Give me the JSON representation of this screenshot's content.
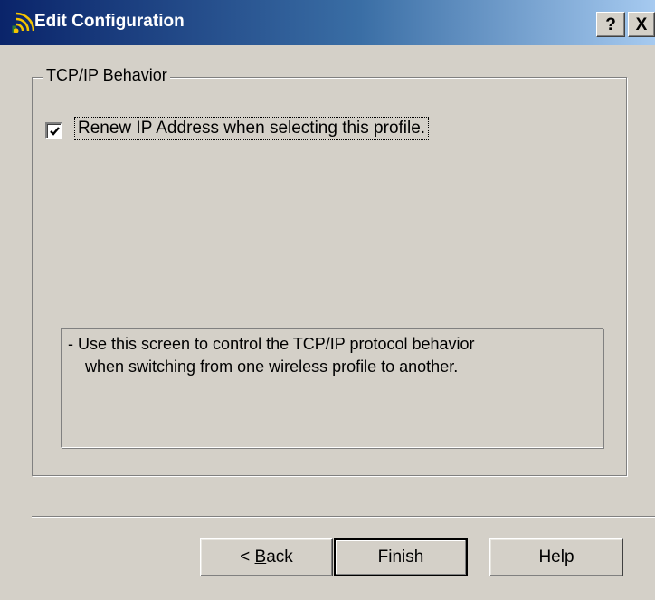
{
  "window": {
    "title": "Edit Configuration",
    "help_button": "?",
    "close_button": "X"
  },
  "group": {
    "title": "TCP/IP Behavior"
  },
  "checkbox": {
    "label": "Renew IP Address when selecting this profile.",
    "checked": true
  },
  "info": {
    "line1": "-  Use this screen to control the TCP/IP protocol behavior",
    "line2": "when switching from one wireless profile to another."
  },
  "buttons": {
    "back_prefix": "< ",
    "back_accel": "B",
    "back_rest": "ack",
    "finish": "Finish",
    "help": "Help"
  },
  "icons": {
    "app": "wireless-signal-icon",
    "check": "check-mark-icon"
  },
  "colors": {
    "titlebar_start": "#0a246a",
    "titlebar_end": "#a6caf0",
    "dialog_face": "#d4d0c8"
  }
}
